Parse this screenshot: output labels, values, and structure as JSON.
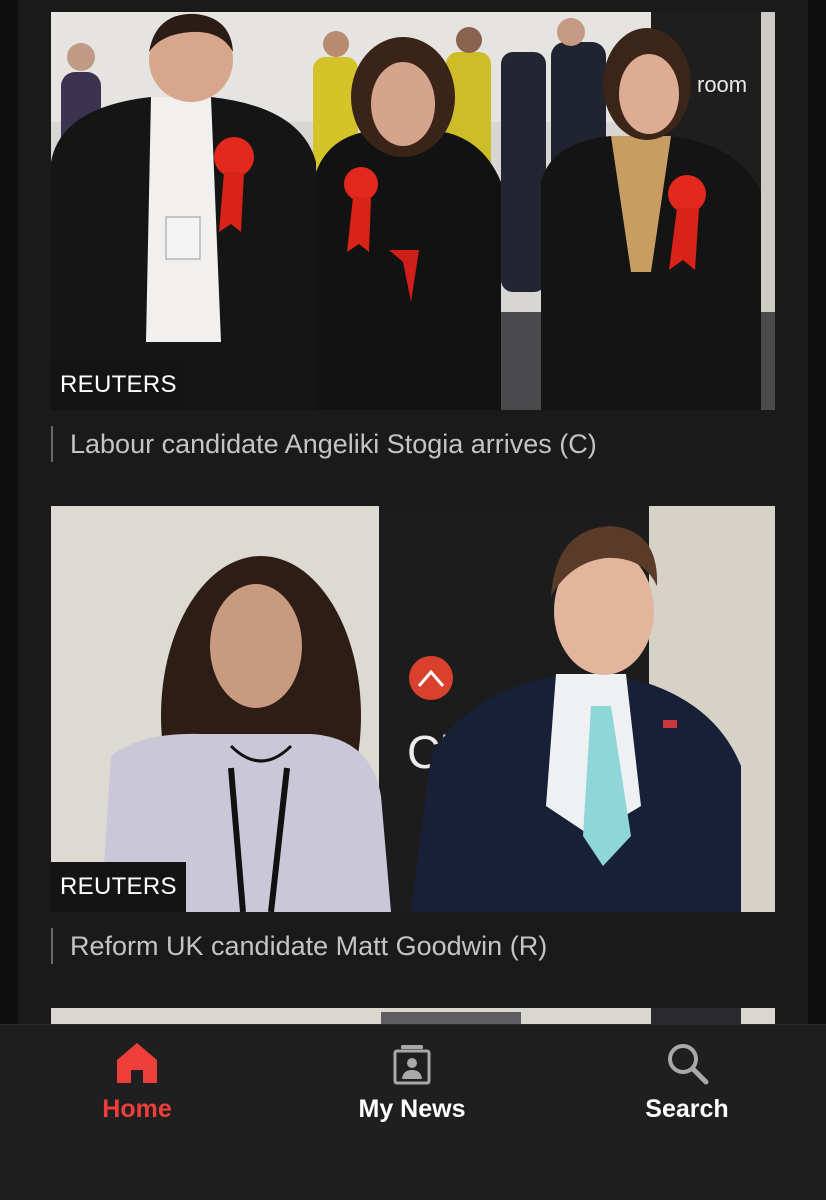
{
  "articles": [
    {
      "credit": "REUTERS",
      "caption": "Labour candidate Angeliki Stogia arrives (C)"
    },
    {
      "credit": "REUTERS",
      "caption": "Reform UK candidate Matt Goodwin (R)"
    }
  ],
  "bottom_nav": {
    "items": [
      {
        "label": "Home",
        "icon": "home-icon",
        "active": true
      },
      {
        "label": "My News",
        "icon": "my-news-icon",
        "active": false
      },
      {
        "label": "Search",
        "icon": "search-icon",
        "active": false
      }
    ]
  },
  "colors": {
    "accent": "#ee3e3a",
    "background": "#1a1a1a",
    "nav_background": "#1f1f1f",
    "caption_text": "#c4c4c4"
  }
}
